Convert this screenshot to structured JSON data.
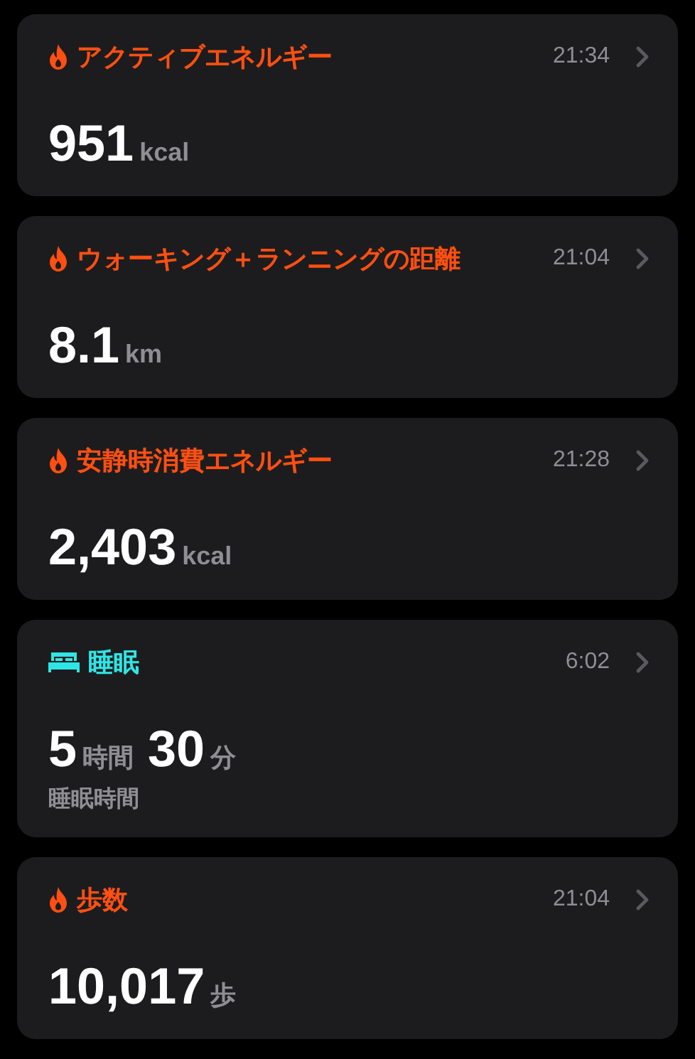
{
  "cards": [
    {
      "kind": "energy",
      "color": "#ff4f12",
      "title": "アクティブエネルギー",
      "time": "21:34",
      "value_parts": [
        {
          "value": "951",
          "unit": "kcal"
        }
      ]
    },
    {
      "kind": "energy",
      "color": "#ff4f12",
      "title": "ウォーキング＋ランニングの距離",
      "time": "21:04",
      "value_parts": [
        {
          "value": "8.1",
          "unit": "km"
        }
      ]
    },
    {
      "kind": "energy",
      "color": "#ff4f12",
      "title": "安静時消費エネルギー",
      "time": "21:28",
      "value_parts": [
        {
          "value": "2,403",
          "unit": "kcal"
        }
      ]
    },
    {
      "kind": "sleep",
      "color": "#2ee6e6",
      "title": "睡眠",
      "time": "6:02",
      "value_parts": [
        {
          "value": "5",
          "unit": "時間"
        },
        {
          "value": "30",
          "unit": "分"
        }
      ],
      "caption": "睡眠時間"
    },
    {
      "kind": "energy",
      "color": "#ff4f12",
      "title": "歩数",
      "time": "21:04",
      "value_parts": [
        {
          "value": "10,017",
          "unit": "歩"
        }
      ]
    }
  ]
}
